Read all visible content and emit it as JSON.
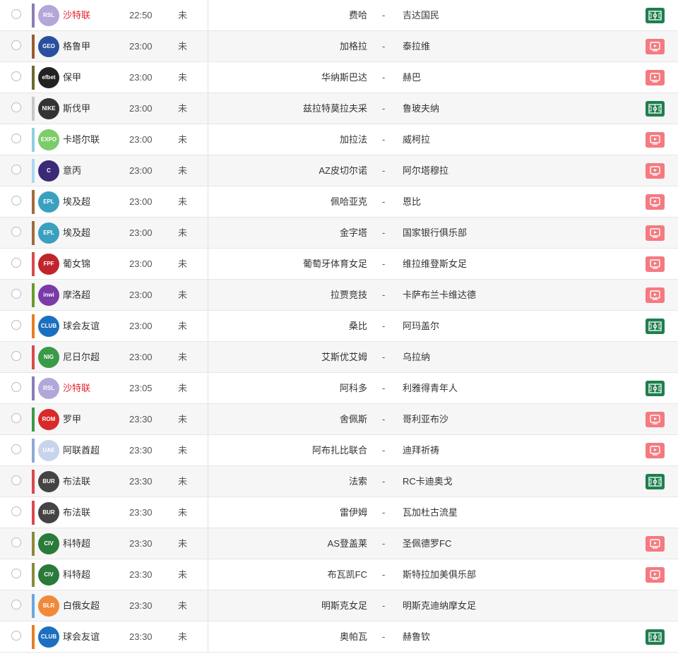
{
  "colors": {
    "hot_league": "#e8222e",
    "tv_icon": "#f47a80",
    "field_icon": "#1e7f4e",
    "row_alt_bg": "#f6f6f6"
  },
  "matches": [
    {
      "league": "沙特联",
      "hot": true,
      "bar_color": "#8c7bb8",
      "logo_color": "#b3a6d9",
      "logo_text": "RSL",
      "time": "22:50",
      "status": "未",
      "home": "费哈",
      "dash": "-",
      "away": "吉达国民",
      "icon": "field-icon"
    },
    {
      "league": "格鲁甲",
      "hot": false,
      "bar_color": "#9a5a2c",
      "logo_color": "#2a4f9e",
      "logo_text": "GEO",
      "time": "23:00",
      "status": "未",
      "home": "加格拉",
      "dash": "-",
      "away": "泰拉维",
      "icon": "tv-icon"
    },
    {
      "league": "保甲",
      "hot": false,
      "bar_color": "#6b6b2a",
      "logo_color": "#222222",
      "logo_text": "efbet",
      "time": "23:00",
      "status": "未",
      "home": "华纳斯巴达",
      "dash": "-",
      "away": "赫巴",
      "icon": "tv-icon"
    },
    {
      "league": "斯伐甲",
      "hot": false,
      "bar_color": "#c8c8c8",
      "logo_color": "#333333",
      "logo_text": "NIKE",
      "time": "23:00",
      "status": "未",
      "home": "兹拉特莫拉夫采",
      "dash": "-",
      "away": "鲁玻夫纳",
      "icon": "field-icon"
    },
    {
      "league": "卡塔尔联",
      "hot": false,
      "bar_color": "#8fd0e0",
      "logo_color": "#7ccc6a",
      "logo_text": "EXPO",
      "time": "23:00",
      "status": "未",
      "home": "加拉法",
      "dash": "-",
      "away": "威柯拉",
      "icon": "tv-icon"
    },
    {
      "league": "意丙",
      "hot": false,
      "bar_color": "#a6d9f2",
      "logo_color": "#3a2a78",
      "logo_text": "C",
      "time": "23:00",
      "status": "未",
      "home": "AZ皮切尔诺",
      "dash": "-",
      "away": "阿尔塔穆拉",
      "icon": "tv-icon"
    },
    {
      "league": "埃及超",
      "hot": false,
      "bar_color": "#a46a3a",
      "logo_color": "#3aa0c0",
      "logo_text": "EPL",
      "time": "23:00",
      "status": "未",
      "home": "佩哈亚克",
      "dash": "-",
      "away": "恩比",
      "icon": "tv-icon"
    },
    {
      "league": "埃及超",
      "hot": false,
      "bar_color": "#a46a3a",
      "logo_color": "#3aa0c0",
      "logo_text": "EPL",
      "time": "23:00",
      "status": "未",
      "home": "金字塔",
      "dash": "-",
      "away": "国家银行俱乐部",
      "icon": "tv-icon"
    },
    {
      "league": "葡女锦",
      "hot": false,
      "bar_color": "#d9494e",
      "logo_color": "#c0252b",
      "logo_text": "FPF",
      "time": "23:00",
      "status": "未",
      "home": "葡萄牙体育女足",
      "dash": "-",
      "away": "维拉维登斯女足",
      "icon": "tv-icon"
    },
    {
      "league": "摩洛超",
      "hot": false,
      "bar_color": "#6b9a2a",
      "logo_color": "#7a3aa8",
      "logo_text": "inwi",
      "time": "23:00",
      "status": "未",
      "home": "拉贾竞技",
      "dash": "-",
      "away": "卡萨布兰卡维达德",
      "icon": "tv-icon"
    },
    {
      "league": "球会友谊",
      "hot": false,
      "bar_color": "#e67e22",
      "logo_color": "#1c6fc0",
      "logo_text": "CLUB",
      "time": "23:00",
      "status": "未",
      "home": "桑比",
      "dash": "-",
      "away": "阿玛盖尔",
      "icon": "field-icon"
    },
    {
      "league": "尼日尔超",
      "hot": false,
      "bar_color": "#d9494e",
      "logo_color": "#3a9a48",
      "logo_text": "NIG",
      "time": "23:00",
      "status": "未",
      "home": "艾斯优艾姆",
      "dash": "-",
      "away": "乌拉纳",
      "icon": ""
    },
    {
      "league": "沙特联",
      "hot": true,
      "bar_color": "#8c7bb8",
      "logo_color": "#b3a6d9",
      "logo_text": "RSL",
      "time": "23:05",
      "status": "未",
      "home": "阿科多",
      "dash": "-",
      "away": "利雅得青年人",
      "icon": "field-icon"
    },
    {
      "league": "罗甲",
      "hot": false,
      "bar_color": "#3a9a48",
      "logo_color": "#d82a2a",
      "logo_text": "ROM",
      "time": "23:30",
      "status": "未",
      "home": "舍佩斯",
      "dash": "-",
      "away": "哥利亚布沙",
      "icon": "tv-icon"
    },
    {
      "league": "阿联酋超",
      "hot": false,
      "bar_color": "#8fa8d8",
      "logo_color": "#c8d4ee",
      "logo_text": "UAE",
      "time": "23:30",
      "status": "未",
      "home": "阿布扎比联合",
      "dash": "-",
      "away": "迪拜祈祷",
      "icon": "tv-icon"
    },
    {
      "league": "布法联",
      "hot": false,
      "bar_color": "#d9494e",
      "logo_color": "#444444",
      "logo_text": "BUR",
      "time": "23:30",
      "status": "未",
      "home": "法索",
      "dash": "-",
      "away": "RC卡迪奥戈",
      "icon": "field-icon"
    },
    {
      "league": "布法联",
      "hot": false,
      "bar_color": "#d9494e",
      "logo_color": "#444444",
      "logo_text": "BUR",
      "time": "23:30",
      "status": "未",
      "home": "雷伊姆",
      "dash": "-",
      "away": "瓦加杜古流星",
      "icon": ""
    },
    {
      "league": "科特超",
      "hot": false,
      "bar_color": "#8a8a3a",
      "logo_color": "#2a7a3a",
      "logo_text": "CIV",
      "time": "23:30",
      "status": "未",
      "home": "AS登盖莱",
      "dash": "-",
      "away": "圣佩德罗FC",
      "icon": "tv-icon"
    },
    {
      "league": "科特超",
      "hot": false,
      "bar_color": "#8a8a3a",
      "logo_color": "#2a7a3a",
      "logo_text": "CIV",
      "time": "23:30",
      "status": "未",
      "home": "布瓦凯FC",
      "dash": "-",
      "away": "斯特拉加美俱乐部",
      "icon": "tv-icon"
    },
    {
      "league": "白俄女超",
      "hot": false,
      "bar_color": "#6aa8e0",
      "logo_color": "#f08a3a",
      "logo_text": "BLR",
      "time": "23:30",
      "status": "未",
      "home": "明斯克女足",
      "dash": "-",
      "away": "明斯克迪纳摩女足",
      "icon": ""
    },
    {
      "league": "球会友谊",
      "hot": false,
      "bar_color": "#e67e22",
      "logo_color": "#1c6fc0",
      "logo_text": "CLUB",
      "time": "23:30",
      "status": "未",
      "home": "奥帕瓦",
      "dash": "-",
      "away": "赫鲁钦",
      "icon": "field-icon"
    }
  ]
}
